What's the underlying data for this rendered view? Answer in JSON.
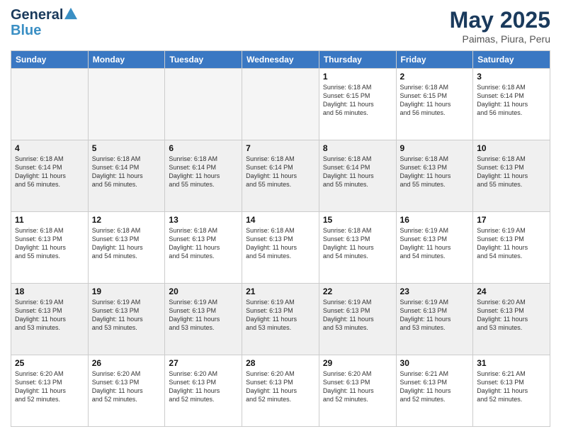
{
  "logo": {
    "line1": "General",
    "line2": "Blue"
  },
  "header": {
    "month": "May 2025",
    "location": "Paimas, Piura, Peru"
  },
  "weekdays": [
    "Sunday",
    "Monday",
    "Tuesday",
    "Wednesday",
    "Thursday",
    "Friday",
    "Saturday"
  ],
  "weeks": [
    [
      {
        "day": "",
        "info": "",
        "empty": true
      },
      {
        "day": "",
        "info": "",
        "empty": true
      },
      {
        "day": "",
        "info": "",
        "empty": true
      },
      {
        "day": "",
        "info": "",
        "empty": true
      },
      {
        "day": "1",
        "info": "Sunrise: 6:18 AM\nSunset: 6:15 PM\nDaylight: 11 hours\nand 56 minutes."
      },
      {
        "day": "2",
        "info": "Sunrise: 6:18 AM\nSunset: 6:15 PM\nDaylight: 11 hours\nand 56 minutes."
      },
      {
        "day": "3",
        "info": "Sunrise: 6:18 AM\nSunset: 6:14 PM\nDaylight: 11 hours\nand 56 minutes."
      }
    ],
    [
      {
        "day": "4",
        "info": "Sunrise: 6:18 AM\nSunset: 6:14 PM\nDaylight: 11 hours\nand 56 minutes."
      },
      {
        "day": "5",
        "info": "Sunrise: 6:18 AM\nSunset: 6:14 PM\nDaylight: 11 hours\nand 56 minutes."
      },
      {
        "day": "6",
        "info": "Sunrise: 6:18 AM\nSunset: 6:14 PM\nDaylight: 11 hours\nand 55 minutes."
      },
      {
        "day": "7",
        "info": "Sunrise: 6:18 AM\nSunset: 6:14 PM\nDaylight: 11 hours\nand 55 minutes."
      },
      {
        "day": "8",
        "info": "Sunrise: 6:18 AM\nSunset: 6:14 PM\nDaylight: 11 hours\nand 55 minutes."
      },
      {
        "day": "9",
        "info": "Sunrise: 6:18 AM\nSunset: 6:13 PM\nDaylight: 11 hours\nand 55 minutes."
      },
      {
        "day": "10",
        "info": "Sunrise: 6:18 AM\nSunset: 6:13 PM\nDaylight: 11 hours\nand 55 minutes."
      }
    ],
    [
      {
        "day": "11",
        "info": "Sunrise: 6:18 AM\nSunset: 6:13 PM\nDaylight: 11 hours\nand 55 minutes."
      },
      {
        "day": "12",
        "info": "Sunrise: 6:18 AM\nSunset: 6:13 PM\nDaylight: 11 hours\nand 54 minutes."
      },
      {
        "day": "13",
        "info": "Sunrise: 6:18 AM\nSunset: 6:13 PM\nDaylight: 11 hours\nand 54 minutes."
      },
      {
        "day": "14",
        "info": "Sunrise: 6:18 AM\nSunset: 6:13 PM\nDaylight: 11 hours\nand 54 minutes."
      },
      {
        "day": "15",
        "info": "Sunrise: 6:18 AM\nSunset: 6:13 PM\nDaylight: 11 hours\nand 54 minutes."
      },
      {
        "day": "16",
        "info": "Sunrise: 6:19 AM\nSunset: 6:13 PM\nDaylight: 11 hours\nand 54 minutes."
      },
      {
        "day": "17",
        "info": "Sunrise: 6:19 AM\nSunset: 6:13 PM\nDaylight: 11 hours\nand 54 minutes."
      }
    ],
    [
      {
        "day": "18",
        "info": "Sunrise: 6:19 AM\nSunset: 6:13 PM\nDaylight: 11 hours\nand 53 minutes."
      },
      {
        "day": "19",
        "info": "Sunrise: 6:19 AM\nSunset: 6:13 PM\nDaylight: 11 hours\nand 53 minutes."
      },
      {
        "day": "20",
        "info": "Sunrise: 6:19 AM\nSunset: 6:13 PM\nDaylight: 11 hours\nand 53 minutes."
      },
      {
        "day": "21",
        "info": "Sunrise: 6:19 AM\nSunset: 6:13 PM\nDaylight: 11 hours\nand 53 minutes."
      },
      {
        "day": "22",
        "info": "Sunrise: 6:19 AM\nSunset: 6:13 PM\nDaylight: 11 hours\nand 53 minutes."
      },
      {
        "day": "23",
        "info": "Sunrise: 6:19 AM\nSunset: 6:13 PM\nDaylight: 11 hours\nand 53 minutes."
      },
      {
        "day": "24",
        "info": "Sunrise: 6:20 AM\nSunset: 6:13 PM\nDaylight: 11 hours\nand 53 minutes."
      }
    ],
    [
      {
        "day": "25",
        "info": "Sunrise: 6:20 AM\nSunset: 6:13 PM\nDaylight: 11 hours\nand 52 minutes."
      },
      {
        "day": "26",
        "info": "Sunrise: 6:20 AM\nSunset: 6:13 PM\nDaylight: 11 hours\nand 52 minutes."
      },
      {
        "day": "27",
        "info": "Sunrise: 6:20 AM\nSunset: 6:13 PM\nDaylight: 11 hours\nand 52 minutes."
      },
      {
        "day": "28",
        "info": "Sunrise: 6:20 AM\nSunset: 6:13 PM\nDaylight: 11 hours\nand 52 minutes."
      },
      {
        "day": "29",
        "info": "Sunrise: 6:20 AM\nSunset: 6:13 PM\nDaylight: 11 hours\nand 52 minutes."
      },
      {
        "day": "30",
        "info": "Sunrise: 6:21 AM\nSunset: 6:13 PM\nDaylight: 11 hours\nand 52 minutes."
      },
      {
        "day": "31",
        "info": "Sunrise: 6:21 AM\nSunset: 6:13 PM\nDaylight: 11 hours\nand 52 minutes."
      }
    ]
  ]
}
